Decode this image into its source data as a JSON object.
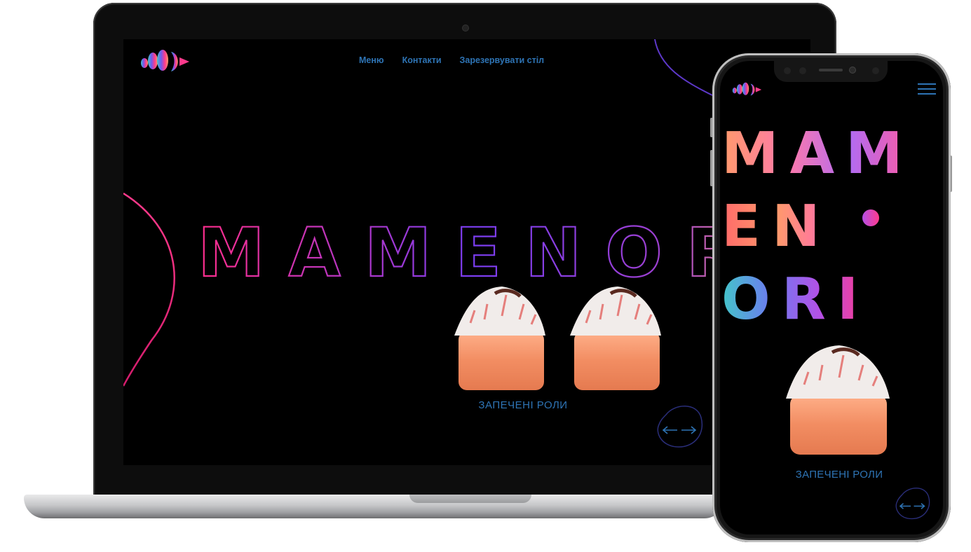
{
  "brand": {
    "name": "MAMENORI",
    "mobile_lines": [
      "MAM",
      "EN",
      "ORI"
    ]
  },
  "desktop": {
    "nav": [
      "Меню",
      "Контакти",
      "Зарезервувати стіл"
    ],
    "caption": "ЗАПЕЧЕНІ РОЛИ",
    "arrows": "←→"
  },
  "mobile": {
    "caption": "ЗАПЕЧЕНІ РОЛИ",
    "arrows": "←→"
  },
  "colors": {
    "accent": "#2e74b5",
    "gradient_pink": "#ff2d8a",
    "gradient_purple": "#7a3df0",
    "gradient_orange": "#ff9a6b",
    "gradient_teal": "#43c6c9"
  },
  "icons": [
    "logo-icon",
    "arrow-left-icon",
    "arrow-right-icon",
    "menu-icon"
  ]
}
